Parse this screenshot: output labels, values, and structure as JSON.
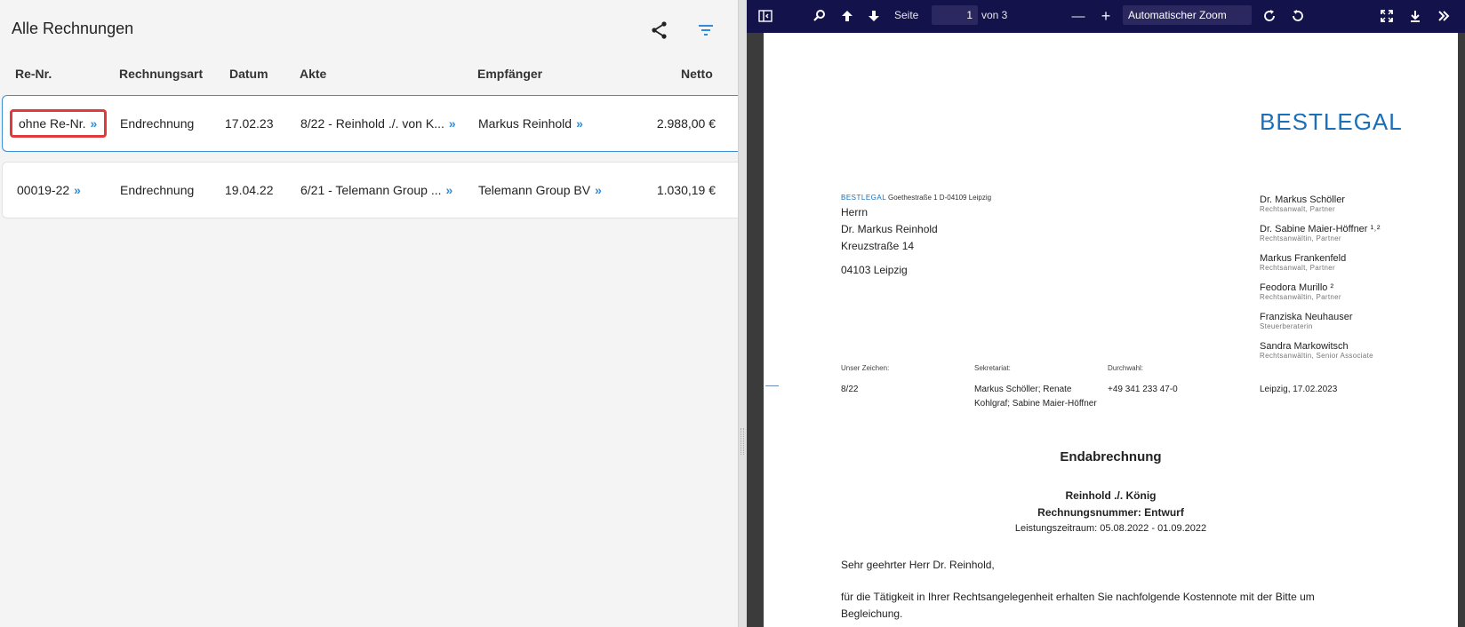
{
  "left": {
    "title": "Alle Rechnungen",
    "icons": {
      "share": "share-icon",
      "filter": "filter-icon"
    },
    "columns": [
      "Re-Nr.",
      "Rechnungsart",
      "Datum",
      "Akte",
      "Empfänger",
      "Netto"
    ],
    "rows": [
      {
        "renr": "ohne Re-Nr.",
        "art": "Endrechnung",
        "datum": "17.02.23",
        "akte": "8/22 - Reinhold ./. von K...",
        "empfaenger": "Markus Reinhold",
        "netto": "2.988,00 €"
      },
      {
        "renr": "00019-22",
        "art": "Endrechnung",
        "datum": "19.04.22",
        "akte": "6/21 - Telemann Group ...",
        "empfaenger": "Telemann Group BV",
        "netto": "1.030,19 €"
      }
    ],
    "chevron": "»"
  },
  "viewer": {
    "page_label": "Seite",
    "page_number": "1",
    "page_total": "von 3",
    "zoom": "Automatischer Zoom",
    "minus": "—",
    "plus": "+"
  },
  "pdf": {
    "brand": "BESTLEGAL",
    "small_brand": "BESTLEGAL",
    "sender": "Goethestraße 1   D-04109 Leipzig",
    "address": [
      "Herrn",
      "Dr. Markus Reinhold",
      "Kreuzstraße 14",
      "04103 Leipzig"
    ],
    "partners": [
      {
        "name": "Dr. Markus Schöller",
        "role": "Rechtsanwalt, Partner"
      },
      {
        "name": "Dr. Sabine Maier-Höffner ¹˒²",
        "role": "Rechtsanwältin, Partner"
      },
      {
        "name": "Markus Frankenfeld",
        "role": "Rechtsanwalt, Partner"
      },
      {
        "name": "Feodora Murillo ²",
        "role": "Rechtsanwältin, Partner"
      },
      {
        "name": "Franziska Neuhauser",
        "role": "Steuerberaterin"
      },
      {
        "name": "Sandra Markowitsch",
        "role": "Rechtsanwältin, Senior Associate"
      }
    ],
    "meta": {
      "zeichen_label": "Unser Zeichen:",
      "zeichen": "8/22",
      "sekretariat_label": "Sekretariat:",
      "sekretariat_1": "Markus Schöller; Renate",
      "sekretariat_2": "Kohlgraf; Sabine Maier-Höffner",
      "durchwahl_label": "Durchwahl:",
      "durchwahl": "+49 341 233 47-0",
      "datum": "Leipzig, 17.02.2023"
    },
    "title": "Endabrechnung",
    "case": "Reinhold ./. König",
    "invoice_no": "Rechnungsnummer: Entwurf",
    "period": "Leistungszeitraum: 05.08.2022 - 01.09.2022",
    "salutation": "Sehr geehrter Herr Dr. Reinhold,",
    "body_1": "für die Tätigkeit in Ihrer Rechtsangelegenheit erhalten Sie nachfolgende Kostennote mit der Bitte um",
    "body_2": "Begleichung."
  }
}
